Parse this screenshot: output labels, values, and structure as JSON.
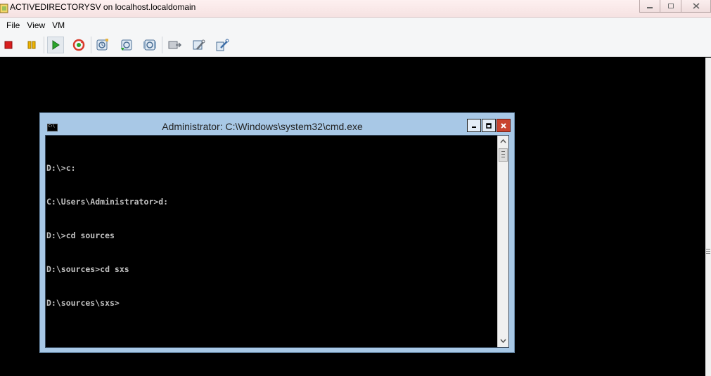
{
  "host_window": {
    "title": "ACTIVEDIRECTORYSV on localhost.localdomain",
    "minimize_icon": "minimize-icon",
    "restore_icon": "restore-icon",
    "close_icon": "close-icon"
  },
  "menu": {
    "items": [
      {
        "label": "File"
      },
      {
        "label": "View"
      },
      {
        "label": "VM"
      }
    ]
  },
  "toolbar": {
    "buttons": [
      {
        "icon": "stop-icon",
        "color": "#d81e1e"
      },
      {
        "icon": "pause-icon",
        "color": "#f0b400"
      },
      {
        "icon": "play-icon",
        "color": "#2aa52a"
      },
      {
        "icon": "reset-icon",
        "color": "#d83a2a"
      },
      {
        "icon": "snapshot-icon"
      },
      {
        "icon": "revert-snapshot-icon"
      },
      {
        "icon": "snapshot-manager-icon"
      },
      {
        "icon": "send-ctrl-alt-del-icon"
      },
      {
        "icon": "vm-settings-icon"
      },
      {
        "icon": "vm-tools-icon"
      }
    ]
  },
  "cmd": {
    "title": "Administrator: C:\\Windows\\system32\\cmd.exe",
    "icon_text": "C:\\",
    "lines": [
      "D:\\>c:",
      "C:\\Users\\Administrator>d:",
      "D:\\>cd sources",
      "D:\\sources>cd sxs",
      "D:\\sources\\sxs>"
    ]
  }
}
